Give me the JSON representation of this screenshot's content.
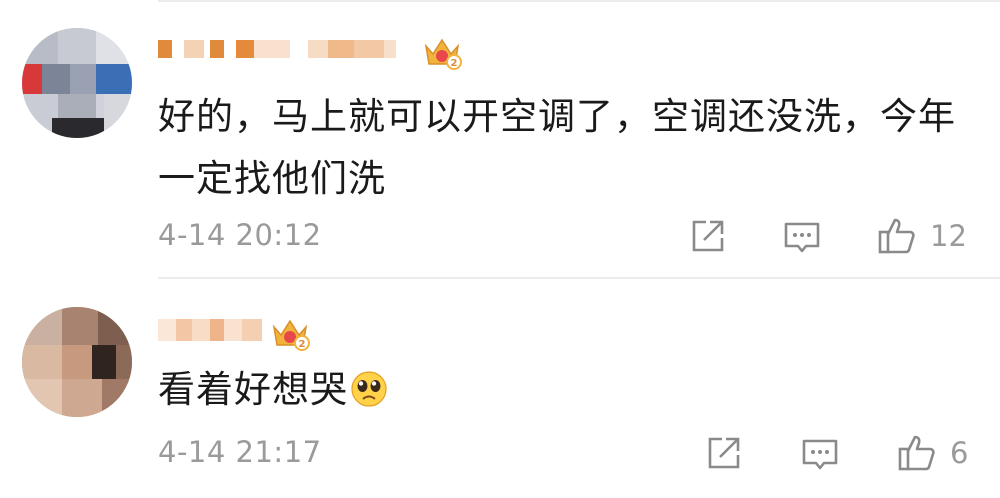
{
  "comments": [
    {
      "text": "好的，马上就可以开空调了，空调还没洗，今年一定找他们洗",
      "timestamp": "4-14 20:12",
      "like_count": "12",
      "icons": {
        "share": "share-icon",
        "comment": "comment-icon",
        "like": "thumbs-up-icon",
        "badge": "crown-badge-icon"
      }
    },
    {
      "text": "看着好想哭",
      "emoji": "pleading-face-emoji",
      "timestamp": "4-14 21:17",
      "like_count": "6",
      "icons": {
        "share": "share-icon",
        "comment": "comment-icon",
        "like": "thumbs-up-icon",
        "badge": "crown-badge-icon"
      }
    }
  ],
  "colors": {
    "text": "#1a1a1a",
    "meta": "#9a9a9a",
    "divider": "#ececec",
    "icon_stroke": "#8a8a8a",
    "crown_gold": "#f2b33d",
    "crown_red": "#e8484a"
  }
}
